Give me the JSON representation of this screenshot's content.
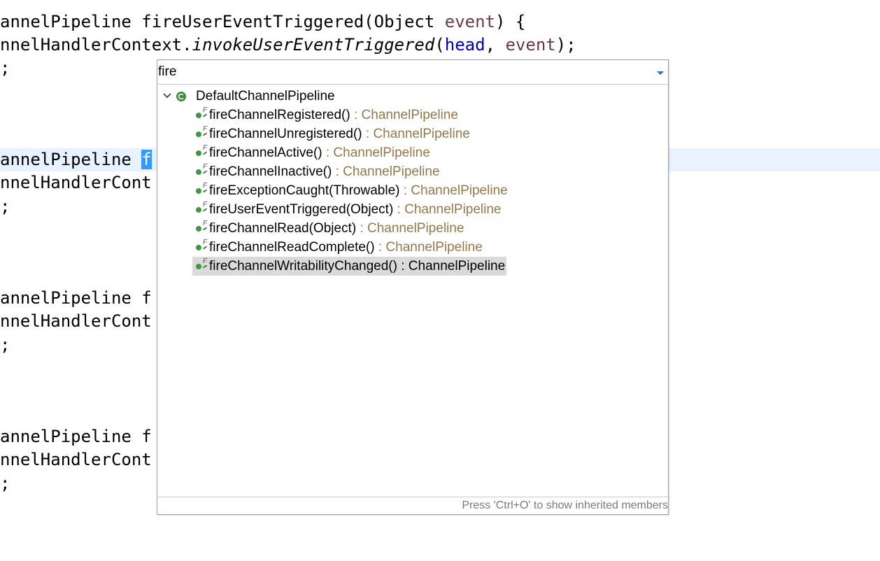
{
  "editor": {
    "lines": [
      {
        "pre": "annelPipeline fireUserEventTriggered(Object ",
        "param": "event",
        "post": ") {"
      },
      {
        "pre": "nnelHandlerContext.",
        "ital": "invokeUserEventTriggered",
        "open": "(",
        "field": "head",
        "sep": ", ",
        "param": "event",
        "post": ");"
      },
      {
        "text": ";"
      },
      {
        "pre": "annelPipeline ",
        "selected": "f"
      },
      {
        "text": "nnelHandlerCont"
      },
      {
        "text": ";"
      },
      {
        "text": "annelPipeline f"
      },
      {
        "text": "nnelHandlerCont"
      },
      {
        "text": ";"
      },
      {
        "text": "annelPipeline f"
      },
      {
        "text": "nnelHandlerCont"
      },
      {
        "text": ";"
      }
    ]
  },
  "popup": {
    "filter_value": "fire",
    "class_name": "DefaultChannelPipeline",
    "members": [
      {
        "name": "fireChannelRegistered()",
        "type": " : ChannelPipeline"
      },
      {
        "name": "fireChannelUnregistered()",
        "type": " : ChannelPipeline"
      },
      {
        "name": "fireChannelActive()",
        "type": " : ChannelPipeline"
      },
      {
        "name": "fireChannelInactive()",
        "type": " : ChannelPipeline"
      },
      {
        "name": "fireExceptionCaught(Throwable)",
        "type": " : ChannelPipeline"
      },
      {
        "name": "fireUserEventTriggered(Object)",
        "type": " : ChannelPipeline"
      },
      {
        "name": "fireChannelRead(Object)",
        "type": " : ChannelPipeline"
      },
      {
        "name": "fireChannelReadComplete()",
        "type": " : ChannelPipeline"
      },
      {
        "name": "fireChannelWritabilityChanged()",
        "type": " : ChannelPipeline"
      }
    ],
    "selected_index": 8,
    "footer_hint": "Press 'Ctrl+O' to show inherited members",
    "icons": {
      "class": "class-icon",
      "method": "public-static-final-method-icon",
      "dropdown": "dropdown-arrow-icon",
      "twisty": "chevron-down-icon"
    }
  },
  "colors": {
    "param": "#6a3e3e",
    "field": "#0000c0",
    "return_type": "#95784a",
    "selection": "#3399ff",
    "line_highlight": "#e8f2fe",
    "method_dot": "#3b9a3b"
  }
}
